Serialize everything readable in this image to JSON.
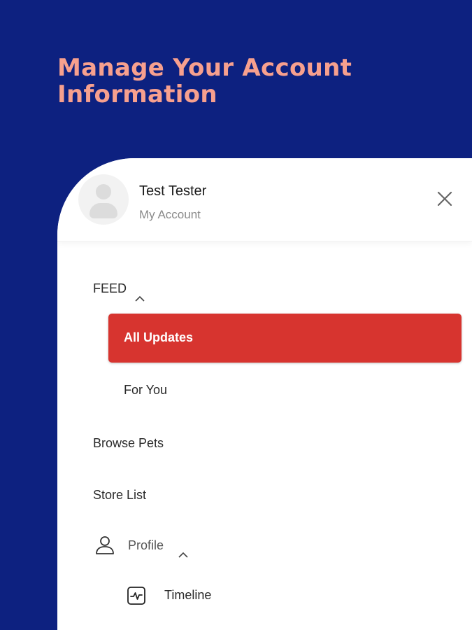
{
  "headline": {
    "line1": "Manage Your Account",
    "line2": "Information"
  },
  "account": {
    "name": "Test Tester",
    "subtitle": "My Account"
  },
  "menu": {
    "feed_section": "FEED",
    "feed_items": [
      "All Updates",
      "For You"
    ],
    "active_item": "All Updates",
    "browse_pets": "Browse Pets",
    "store_list": "Store List",
    "profile_section": "Profile",
    "profile_items": [
      "Timeline"
    ]
  },
  "colors": {
    "background": "#0d2180",
    "headline": "#f7a08e",
    "active": "#d7342f",
    "panel": "#ffffff"
  },
  "icons": {
    "close": "close-icon",
    "avatar": "user-avatar-icon",
    "profile": "person-icon",
    "timeline": "activity-pulse-icon",
    "expand": "chevron-up-icon"
  }
}
